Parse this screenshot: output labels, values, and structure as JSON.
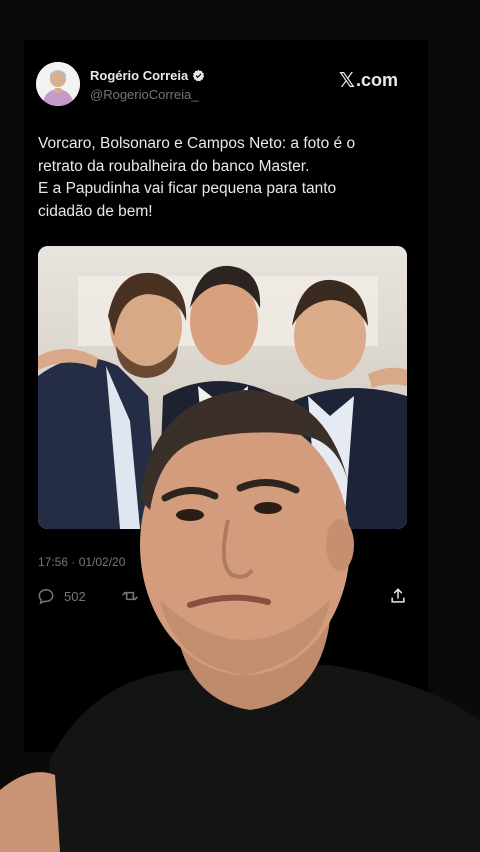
{
  "tweet": {
    "author_name": "Rogério Correia",
    "handle": "@RogerioCorreia_",
    "site_label": ".com",
    "text_lines": [
      "Vorcaro, Bolsonaro e Campos Neto: a foto é o",
      "retrato da roubalheira do banco Master.",
      "E a Papudinha vai ficar pequena para tanto",
      "cidadão de bem!"
    ],
    "timestamp": "17:56 · 01/02/20",
    "reply_count": "502",
    "icons": {
      "verified": "verified-badge-icon",
      "x_logo": "x-logo-icon",
      "reply": "reply-icon",
      "retweet": "retweet-icon",
      "share": "share-icon"
    }
  },
  "colors": {
    "background": "#0a0a0a",
    "card": "#000000",
    "text": "#e7e9ea",
    "muted": "#71767b"
  }
}
